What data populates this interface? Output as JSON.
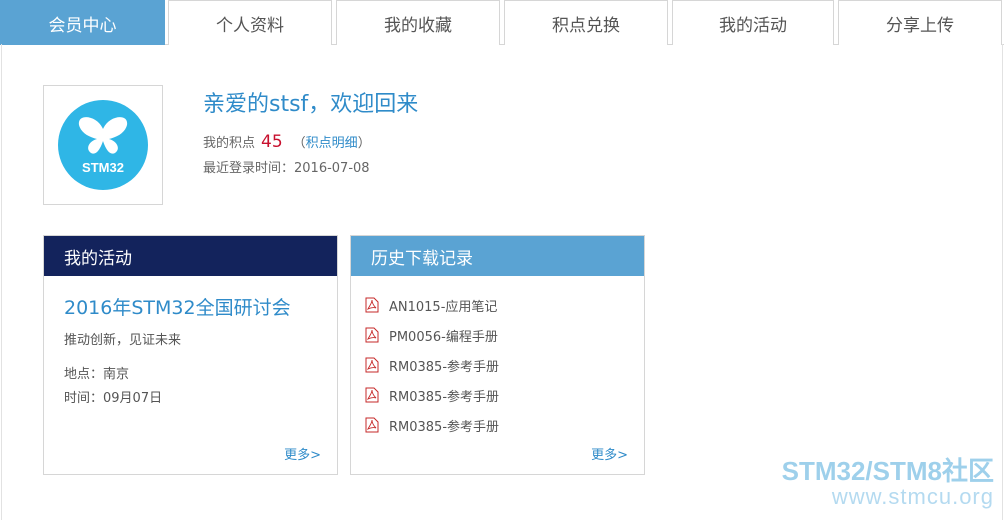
{
  "tabs": [
    {
      "label": "会员中心",
      "active": true
    },
    {
      "label": "个人资料",
      "active": false
    },
    {
      "label": "我的收藏",
      "active": false
    },
    {
      "label": "积点兑换",
      "active": false
    },
    {
      "label": "我的活动",
      "active": false
    },
    {
      "label": "分享上传",
      "active": false
    }
  ],
  "avatar": {
    "logo_text": "STM32"
  },
  "profile": {
    "greeting": "亲爱的stsf，欢迎回来",
    "points_label": "我的积点",
    "points_value": "45",
    "points_detail_open": "（",
    "points_detail_link": "积点明细",
    "points_detail_close": "）",
    "last_login": "最近登录时间：2016-07-08"
  },
  "activity_panel": {
    "title": "我的活动",
    "event_title": "2016年STM32全国研讨会",
    "event_subtitle": "推动创新，见证未来",
    "event_location": "地点：南京",
    "event_time": "时间：09月07日",
    "more_label": "更多>"
  },
  "downloads_panel": {
    "title": "历史下载记录",
    "items": [
      {
        "label": "AN1015-应用笔记",
        "icon": "pdf-icon"
      },
      {
        "label": "PM0056-编程手册",
        "icon": "pdf-icon"
      },
      {
        "label": "RM0385-参考手册",
        "icon": "pdf-icon"
      },
      {
        "label": "RM0385-参考手册",
        "icon": "pdf-icon"
      },
      {
        "label": "RM0385-参考手册",
        "icon": "pdf-icon"
      }
    ],
    "more_label": "更多>"
  },
  "watermark": {
    "line1": "STM32/STM8社区",
    "line2": "www.stmcu.org"
  },
  "colors": {
    "accent": "#5aa3d3",
    "navy": "#13235c",
    "link": "#2f8bc9",
    "points": "#c8102e"
  }
}
